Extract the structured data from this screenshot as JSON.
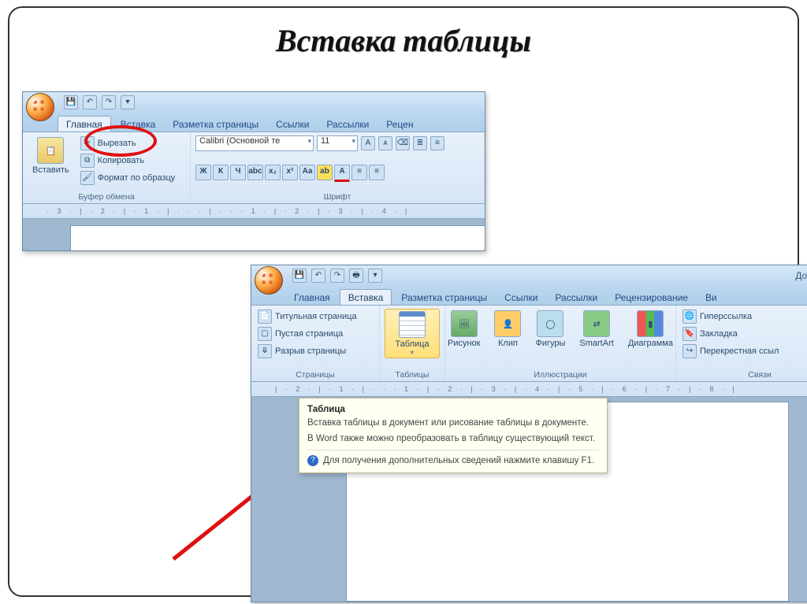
{
  "slide": {
    "title": "Вставка таблицы"
  },
  "win1": {
    "window_title": "",
    "tabs": [
      "Главная",
      "Вставка",
      "Разметка страницы",
      "Ссылки",
      "Рассылки",
      "Рецен"
    ],
    "active_tab_index": 0,
    "circled_tab_index": 1,
    "clipboard": {
      "paste": "Вставить",
      "cut": "Вырезать",
      "copy": "Копировать",
      "format": "Формат по образцу",
      "group_label": "Буфер обмена"
    },
    "font": {
      "name": "Calibri (Основной те",
      "size": "11",
      "group_label": "Шрифт"
    },
    "ruler": "· 3 · | · 2 · | · 1 · | · · · | · · · 1 · | · 2 · | · 3 · | · 4 · |"
  },
  "win2": {
    "window_title": "Докумен",
    "tabs": [
      "Главная",
      "Вставка",
      "Разметка страницы",
      "Ссылки",
      "Рассылки",
      "Рецензирование",
      "Ви"
    ],
    "active_tab_index": 1,
    "pages": {
      "cover": "Титульная страница",
      "blank": "Пустая страница",
      "break": "Разрыв страницы",
      "group_label": "Страницы"
    },
    "tables": {
      "button": "Таблица",
      "group_label": "Таблицы"
    },
    "illustrations": {
      "picture": "Рисунок",
      "clip": "Клип",
      "shapes": "Фигуры",
      "smartart": "SmartArt",
      "chart": "Диаграмма",
      "group_label": "Иллюстрации"
    },
    "links": {
      "hyperlink": "Гиперссылка",
      "bookmark": "Закладка",
      "crossref": "Перекрестная ссыл",
      "group_label": "Связи"
    },
    "tooltip": {
      "title": "Таблица",
      "line1": "Вставка таблицы в документ или рисование таблицы в документе.",
      "line2": "В Word также можно преобразовать в таблицу существующий текст.",
      "help": "Для получения дополнительных сведений нажмите клавишу F1."
    },
    "ruler": "| · 2 · | · 1 · | · · · 1 · | · 2 · | · 3 · | · 4 · | · 5 · | · 6 · | · 7 · | · 8 · |"
  }
}
